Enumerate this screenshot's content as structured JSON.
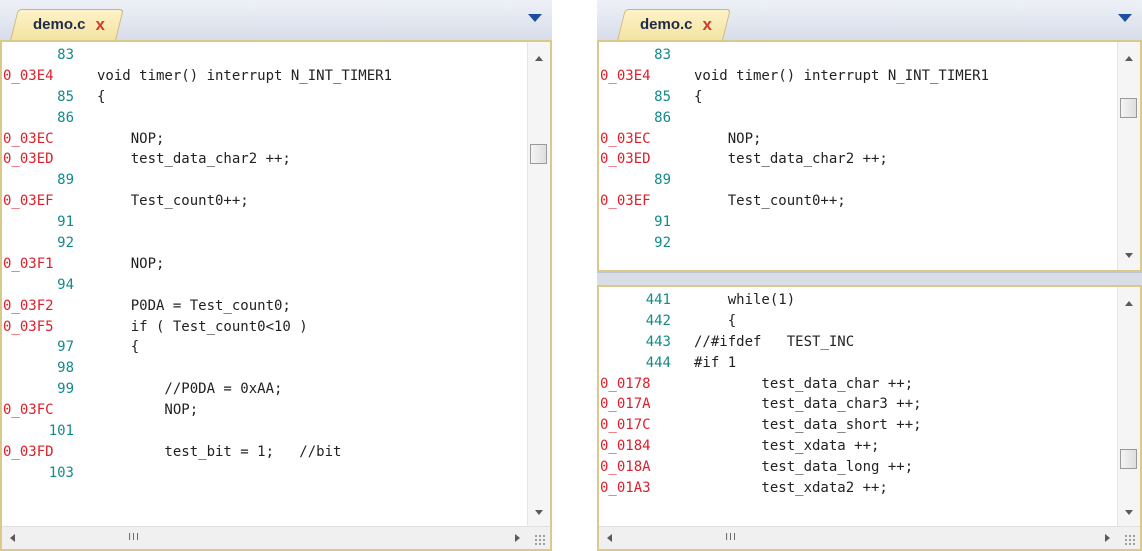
{
  "left_editor": {
    "tab": {
      "label": "demo.c",
      "close_glyph": "x"
    },
    "scrollbar": {
      "hscroll_grip": "III"
    },
    "lines": [
      {
        "num": "83",
        "num_color": "teal",
        "text": ""
      },
      {
        "num": "0_03E4",
        "num_color": "red",
        "text": "void timer() interrupt N_INT_TIMER1"
      },
      {
        "num": "85",
        "num_color": "teal",
        "text": "{"
      },
      {
        "num": "86",
        "num_color": "teal",
        "text": ""
      },
      {
        "num": "0_03EC",
        "num_color": "red",
        "text": "    NOP;"
      },
      {
        "num": "0_03ED",
        "num_color": "red",
        "text": "    test_data_char2 ++;"
      },
      {
        "num": "89",
        "num_color": "teal",
        "text": ""
      },
      {
        "num": "0_03EF",
        "num_color": "red",
        "text": "    Test_count0++;"
      },
      {
        "num": "91",
        "num_color": "teal",
        "text": ""
      },
      {
        "num": "92",
        "num_color": "teal",
        "text": ""
      },
      {
        "num": "0_03F1",
        "num_color": "red",
        "text": "    NOP;"
      },
      {
        "num": "94",
        "num_color": "teal",
        "text": ""
      },
      {
        "num": "0_03F2",
        "num_color": "red",
        "text": "    P0DA = Test_count0;"
      },
      {
        "num": "0_03F5",
        "num_color": "red",
        "text": "    if ( Test_count0<10 )"
      },
      {
        "num": "97",
        "num_color": "teal",
        "text": "    {"
      },
      {
        "num": "98",
        "num_color": "teal",
        "text": ""
      },
      {
        "num": "99",
        "num_color": "teal",
        "text": "        //P0DA = 0xAA;"
      },
      {
        "num": "0_03FC",
        "num_color": "red",
        "text": "        NOP;"
      },
      {
        "num": "101",
        "num_color": "teal",
        "text": ""
      },
      {
        "num": "0_03FD",
        "num_color": "red",
        "text": "        test_bit = 1;   //bit"
      },
      {
        "num": "103",
        "num_color": "teal",
        "text": ""
      }
    ]
  },
  "right_editor": {
    "tab": {
      "label": "demo.c",
      "close_glyph": "x"
    },
    "top_pane": {
      "lines": [
        {
          "num": "83",
          "num_color": "teal",
          "text": ""
        },
        {
          "num": "0_03E4",
          "num_color": "red",
          "text": "void timer() interrupt N_INT_TIMER1"
        },
        {
          "num": "85",
          "num_color": "teal",
          "text": "{"
        },
        {
          "num": "86",
          "num_color": "teal",
          "text": ""
        },
        {
          "num": "0_03EC",
          "num_color": "red",
          "text": "    NOP;"
        },
        {
          "num": "0_03ED",
          "num_color": "red",
          "text": "    test_data_char2 ++;"
        },
        {
          "num": "89",
          "num_color": "teal",
          "text": ""
        },
        {
          "num": "0_03EF",
          "num_color": "red",
          "text": "    Test_count0++;"
        },
        {
          "num": "91",
          "num_color": "teal",
          "text": ""
        },
        {
          "num": "92",
          "num_color": "teal",
          "text": ""
        }
      ]
    },
    "bottom_pane": {
      "hscroll_grip": "III",
      "lines": [
        {
          "num": "441",
          "num_color": "teal",
          "text": "    while(1)"
        },
        {
          "num": "442",
          "num_color": "teal",
          "text": "    {"
        },
        {
          "num": "443",
          "num_color": "teal",
          "text": "//#ifdef   TEST_INC"
        },
        {
          "num": "444",
          "num_color": "teal",
          "text": "#if 1"
        },
        {
          "num": "0_0178",
          "num_color": "red",
          "text": "        test_data_char ++;"
        },
        {
          "num": "0_017A",
          "num_color": "red",
          "text": "        test_data_char3 ++;"
        },
        {
          "num": "0_017C",
          "num_color": "red",
          "text": "        test_data_short ++;"
        },
        {
          "num": "0_0184",
          "num_color": "red",
          "text": "        test_xdata ++;"
        },
        {
          "num": "0_018A",
          "num_color": "red",
          "text": "        test_data_long ++;"
        },
        {
          "num": "0_01A3",
          "num_color": "red",
          "text": "        test_xdata2 ++;"
        }
      ]
    }
  },
  "colors": {
    "address": "#dd1f2b",
    "line_number": "#128a8a",
    "tab": "#f4e3a2",
    "pane_border": "#d9c98a"
  }
}
